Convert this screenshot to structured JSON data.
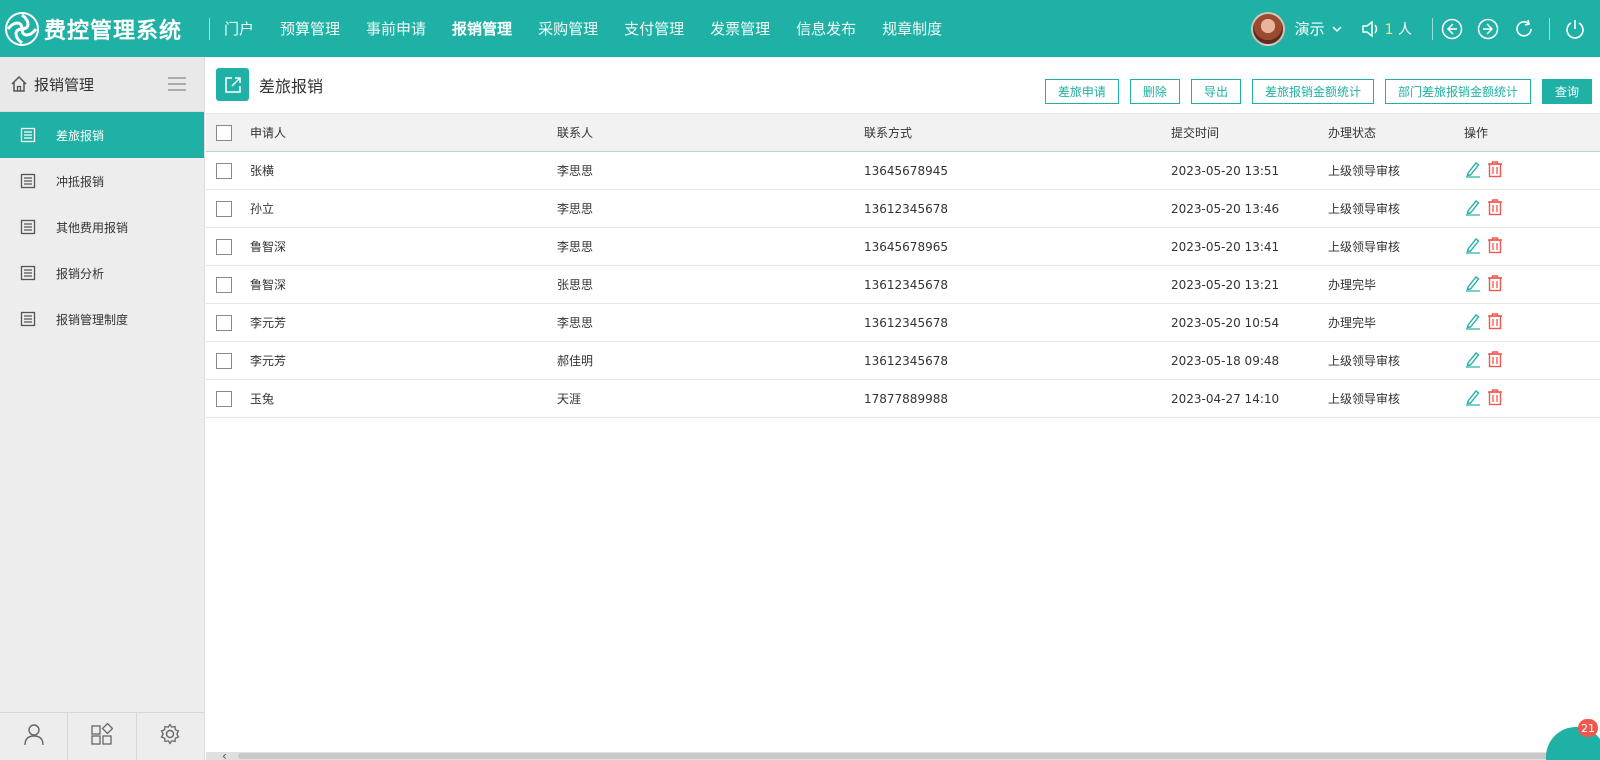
{
  "app": {
    "title": "费控管理系统"
  },
  "nav": {
    "items": [
      {
        "label": "门户"
      },
      {
        "label": "预算管理"
      },
      {
        "label": "事前申请"
      },
      {
        "label": "报销管理",
        "active": true
      },
      {
        "label": "采购管理"
      },
      {
        "label": "支付管理"
      },
      {
        "label": "发票管理"
      },
      {
        "label": "信息发布"
      },
      {
        "label": "规章制度"
      }
    ]
  },
  "user": {
    "name": "演示",
    "online_count": "1",
    "online_unit": "人"
  },
  "sidebar": {
    "title": "报销管理",
    "items": [
      {
        "label": "差旅报销",
        "active": true
      },
      {
        "label": "冲抵报销"
      },
      {
        "label": "其他费用报销"
      },
      {
        "label": "报销分析"
      },
      {
        "label": "报销管理制度"
      }
    ]
  },
  "page": {
    "title": "差旅报销"
  },
  "toolbar": {
    "buttons": [
      {
        "label": "差旅申请"
      },
      {
        "label": "删除"
      },
      {
        "label": "导出"
      },
      {
        "label": "差旅报销金额统计"
      },
      {
        "label": "部门差旅报销金额统计"
      },
      {
        "label": "查询",
        "primary": true
      }
    ]
  },
  "table": {
    "columns": [
      "申请人",
      "联系人",
      "联系方式",
      "提交时间",
      "办理状态",
      "操作"
    ],
    "rows": [
      {
        "applicant": "张横",
        "contact": "李思思",
        "phone": "13645678945",
        "time": "2023-05-20 13:51",
        "status": "上级领导审核"
      },
      {
        "applicant": "孙立",
        "contact": "李思思",
        "phone": "13612345678",
        "time": "2023-05-20 13:46",
        "status": "上级领导审核"
      },
      {
        "applicant": "鲁智深",
        "contact": "李思思",
        "phone": "13645678965",
        "time": "2023-05-20 13:41",
        "status": "上级领导审核"
      },
      {
        "applicant": "鲁智深",
        "contact": "张思思",
        "phone": "13612345678",
        "time": "2023-05-20 13:21",
        "status": "办理完毕"
      },
      {
        "applicant": "李元芳",
        "contact": "李思思",
        "phone": "13612345678",
        "time": "2023-05-20 10:54",
        "status": "办理完毕"
      },
      {
        "applicant": "李元芳",
        "contact": "郝佳明",
        "phone": "13612345678",
        "time": "2023-05-18 09:48",
        "status": "上级领导审核"
      },
      {
        "applicant": "玉兔",
        "contact": "天涯",
        "phone": "17877889988",
        "time": "2023-04-27 14:10",
        "status": "上级领导审核"
      }
    ]
  },
  "notifications": {
    "count": "21"
  },
  "colors": {
    "accent": "#1fb1a5",
    "delete": "#f0584f",
    "badge": "#f0584f"
  }
}
